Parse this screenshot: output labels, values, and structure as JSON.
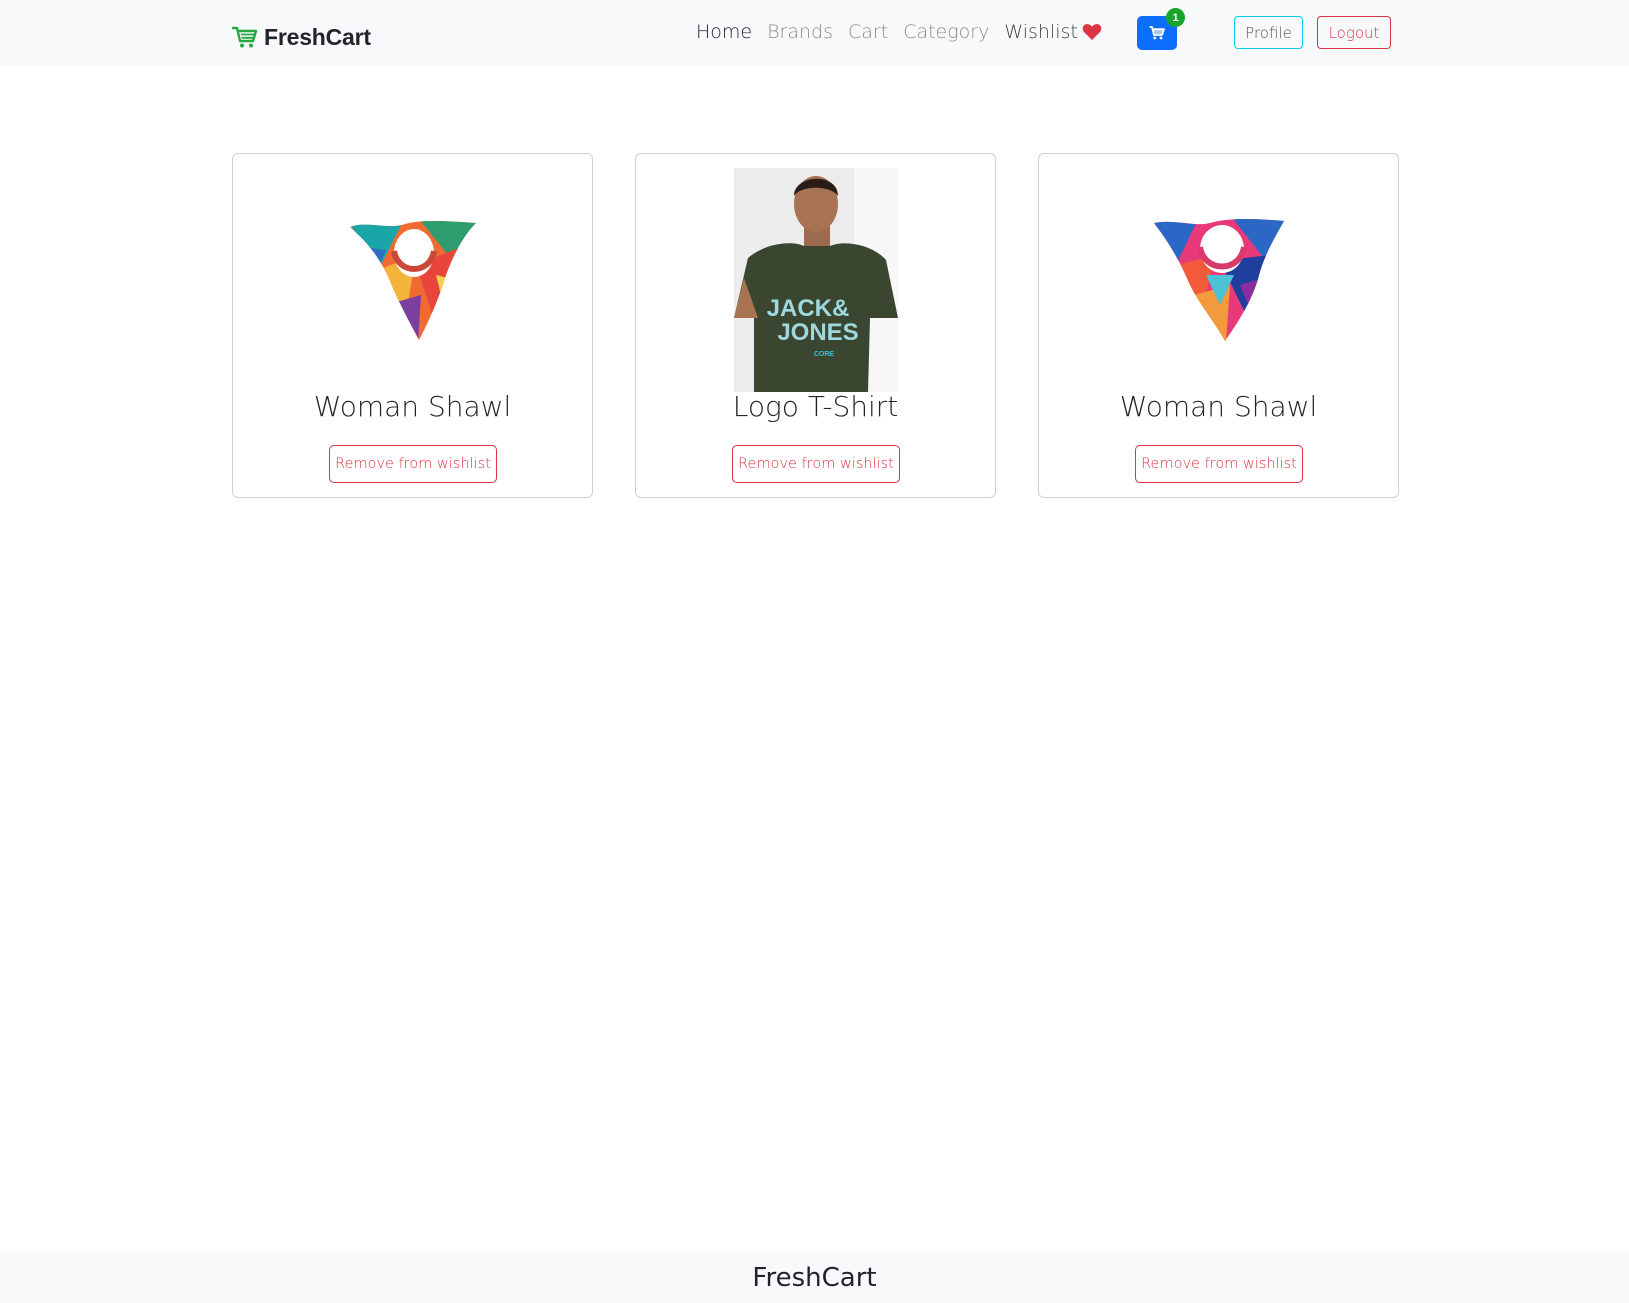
{
  "navbar": {
    "brand": "FreshCart",
    "brand_icon": "shopping-cart-icon",
    "links": [
      {
        "label": "Home",
        "active": true
      },
      {
        "label": "Brands",
        "active": false
      },
      {
        "label": "Cart",
        "active": false
      },
      {
        "label": "Category",
        "active": false
      },
      {
        "label": "Wishlist",
        "active": false
      }
    ],
    "wishlist_icon": "heart-icon",
    "cart_count": "1",
    "profile_label": "Profile",
    "logout_label": "Logout"
  },
  "wishlist": {
    "items": [
      {
        "title": "Woman Shawl",
        "image": "colorful-shawl-1",
        "button": "Remove from wishlist"
      },
      {
        "title": "Logo T-Shirt",
        "image": "jack-jones-tshirt",
        "button": "Remove from wishlist"
      },
      {
        "title": "Woman Shawl",
        "image": "colorful-shawl-2",
        "button": "Remove from wishlist"
      }
    ]
  },
  "footer": {
    "text": "FreshCart"
  },
  "colors": {
    "brand_green": "#28a745",
    "primary": "#0d6efd",
    "danger": "#dc3545",
    "info": "#0dcaf0",
    "badge_green": "#18a32a",
    "heart_red": "#dc3545"
  }
}
